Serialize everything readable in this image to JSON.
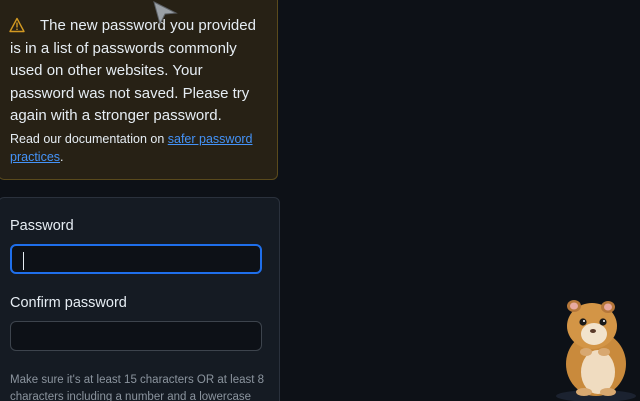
{
  "flash": {
    "icon": "alert-triangle-icon",
    "message": "The new password you provided is in a list of passwords commonly used on other websites. Your password was not saved. Please try again with a stronger password.",
    "doc_prefix": "Read our documentation on ",
    "doc_link": "safer password practices",
    "doc_suffix": "."
  },
  "form": {
    "password_label": "Password",
    "password_value": "",
    "confirm_label": "Confirm password",
    "confirm_value": "",
    "hint": "Make sure it's at least 15 characters OR at least 8 characters including a number and a lowercase"
  },
  "colors": {
    "background": "#0d1117",
    "warning_bg": "#272115",
    "link": "#4493f8",
    "focus": "#1f6feb",
    "warning_icon": "#d29922"
  }
}
